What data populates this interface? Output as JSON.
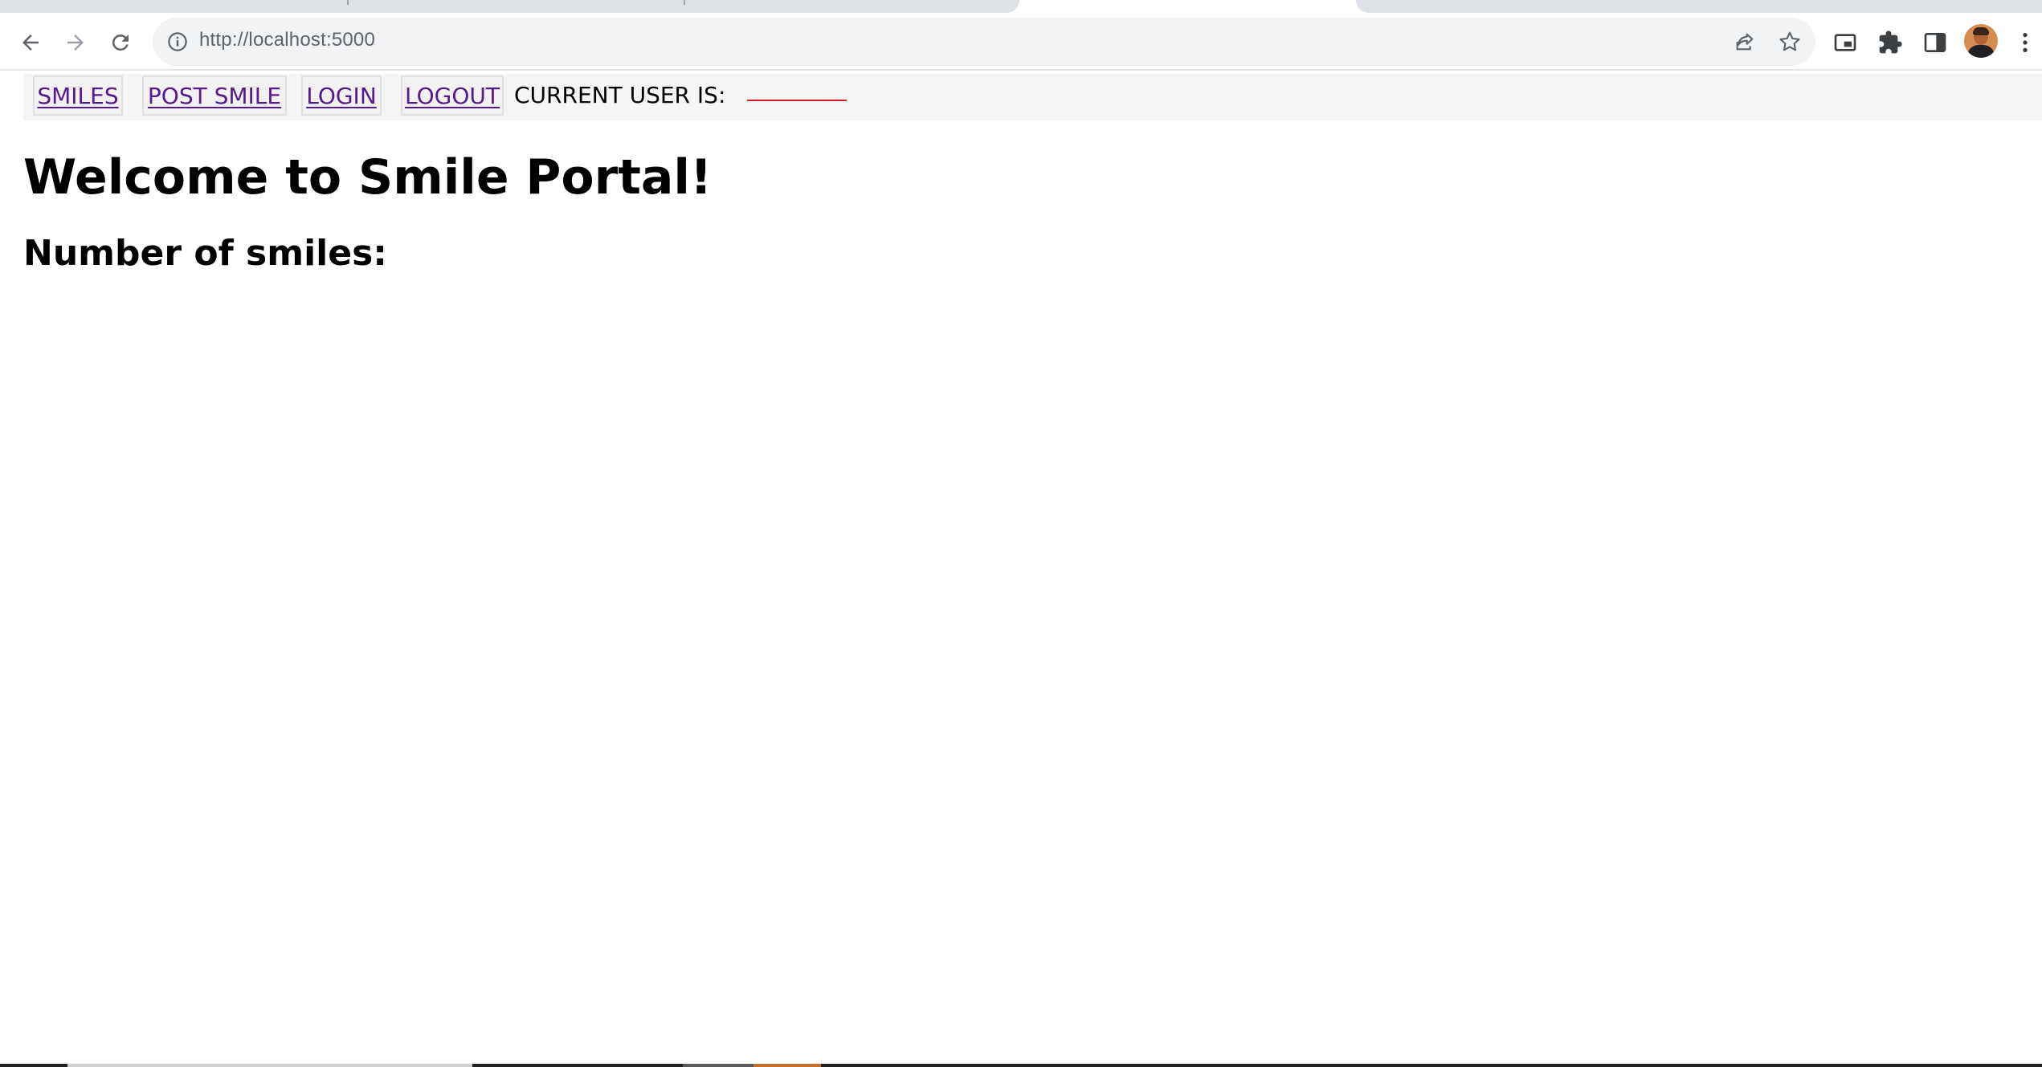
{
  "browser": {
    "address_bar": {
      "url": "http://localhost:5000"
    },
    "icons": {
      "back": "arrow-left-icon",
      "forward": "arrow-right-icon",
      "reload": "reload-icon",
      "site_info": "info-icon",
      "share": "share-icon",
      "bookmark": "star-icon",
      "picture_in_picture": "picture-in-picture-icon",
      "extensions": "puzzle-icon",
      "side_panel": "side-panel-icon",
      "profile": "avatar",
      "menu": "kebab-menu-icon"
    }
  },
  "page": {
    "nav": {
      "links": [
        {
          "label": "SMILES"
        },
        {
          "label": "POST SMILE"
        },
        {
          "label": "LOGIN"
        },
        {
          "label": "LOGOUT"
        }
      ],
      "current_user_label": "CURRENT USER IS:",
      "current_user_value": ""
    },
    "title": "Welcome to Smile Portal!",
    "smile_count_label": "Number of smiles:",
    "colors": {
      "link": "#551a8b",
      "current_user_underline": "#d21f2a",
      "navbar_bg": "#f5f5f5"
    }
  }
}
